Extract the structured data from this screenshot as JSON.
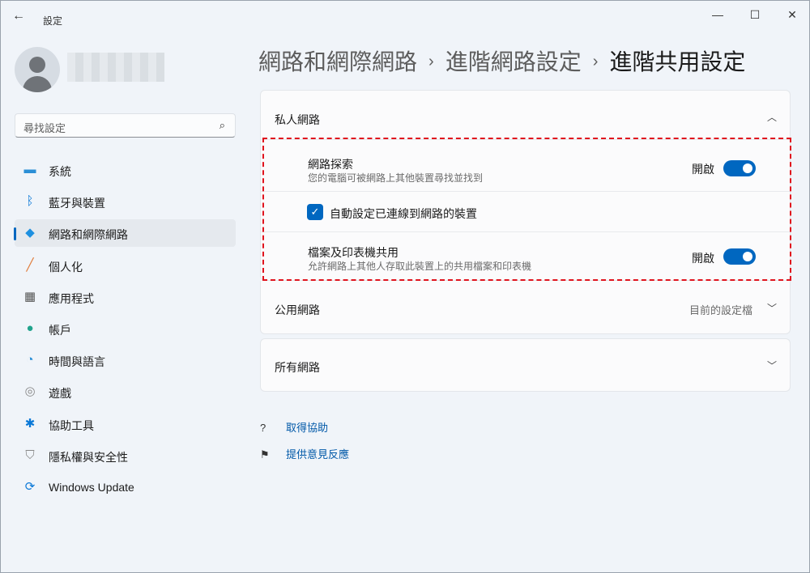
{
  "window": {
    "title": "設定",
    "back_icon": "←",
    "minimize": "—",
    "maximize": "☐",
    "close": "✕"
  },
  "search": {
    "placeholder": "尋找設定",
    "icon": "⌕"
  },
  "sidebar": {
    "items": [
      {
        "label": "系統",
        "icon": "▬",
        "color": "#2b8fd6"
      },
      {
        "label": "藍牙與裝置",
        "icon": "ᛒ",
        "color": "#0a78d7"
      },
      {
        "label": "網路和網際網路",
        "icon": "◆",
        "color": "#1e90e0"
      },
      {
        "label": "個人化",
        "icon": "╱",
        "color": "#e07b39"
      },
      {
        "label": "應用程式",
        "icon": "▦",
        "color": "#555"
      },
      {
        "label": "帳戶",
        "icon": "●",
        "color": "#21a38c"
      },
      {
        "label": "時間與語言",
        "icon": "◔",
        "color": "#2b8fd6"
      },
      {
        "label": "遊戲",
        "icon": "◎",
        "color": "#888"
      },
      {
        "label": "協助工具",
        "icon": "✱",
        "color": "#0a78d7"
      },
      {
        "label": "隱私權與安全性",
        "icon": "⛉",
        "color": "#888"
      },
      {
        "label": "Windows Update",
        "icon": "⟳",
        "color": "#0a78d7"
      }
    ]
  },
  "breadcrumb": [
    "網路和網際網路",
    "進階網路設定",
    "進階共用設定"
  ],
  "private": {
    "title": "私人網路",
    "discovery": {
      "title": "網路探索",
      "desc": "您的電腦可被網路上其他裝置尋找並找到",
      "state": "開啟"
    },
    "auto": {
      "label": "自動設定已連線到網路的裝置",
      "checked": true
    },
    "sharing": {
      "title": "檔案及印表機共用",
      "desc": "允許網路上其他人存取此裝置上的共用檔案和印表機",
      "state": "開啟"
    }
  },
  "public": {
    "title": "公用網路",
    "value": "目前的設定檔"
  },
  "all": {
    "title": "所有網路"
  },
  "links": {
    "help": "取得協助",
    "feedback": "提供意見反應"
  }
}
